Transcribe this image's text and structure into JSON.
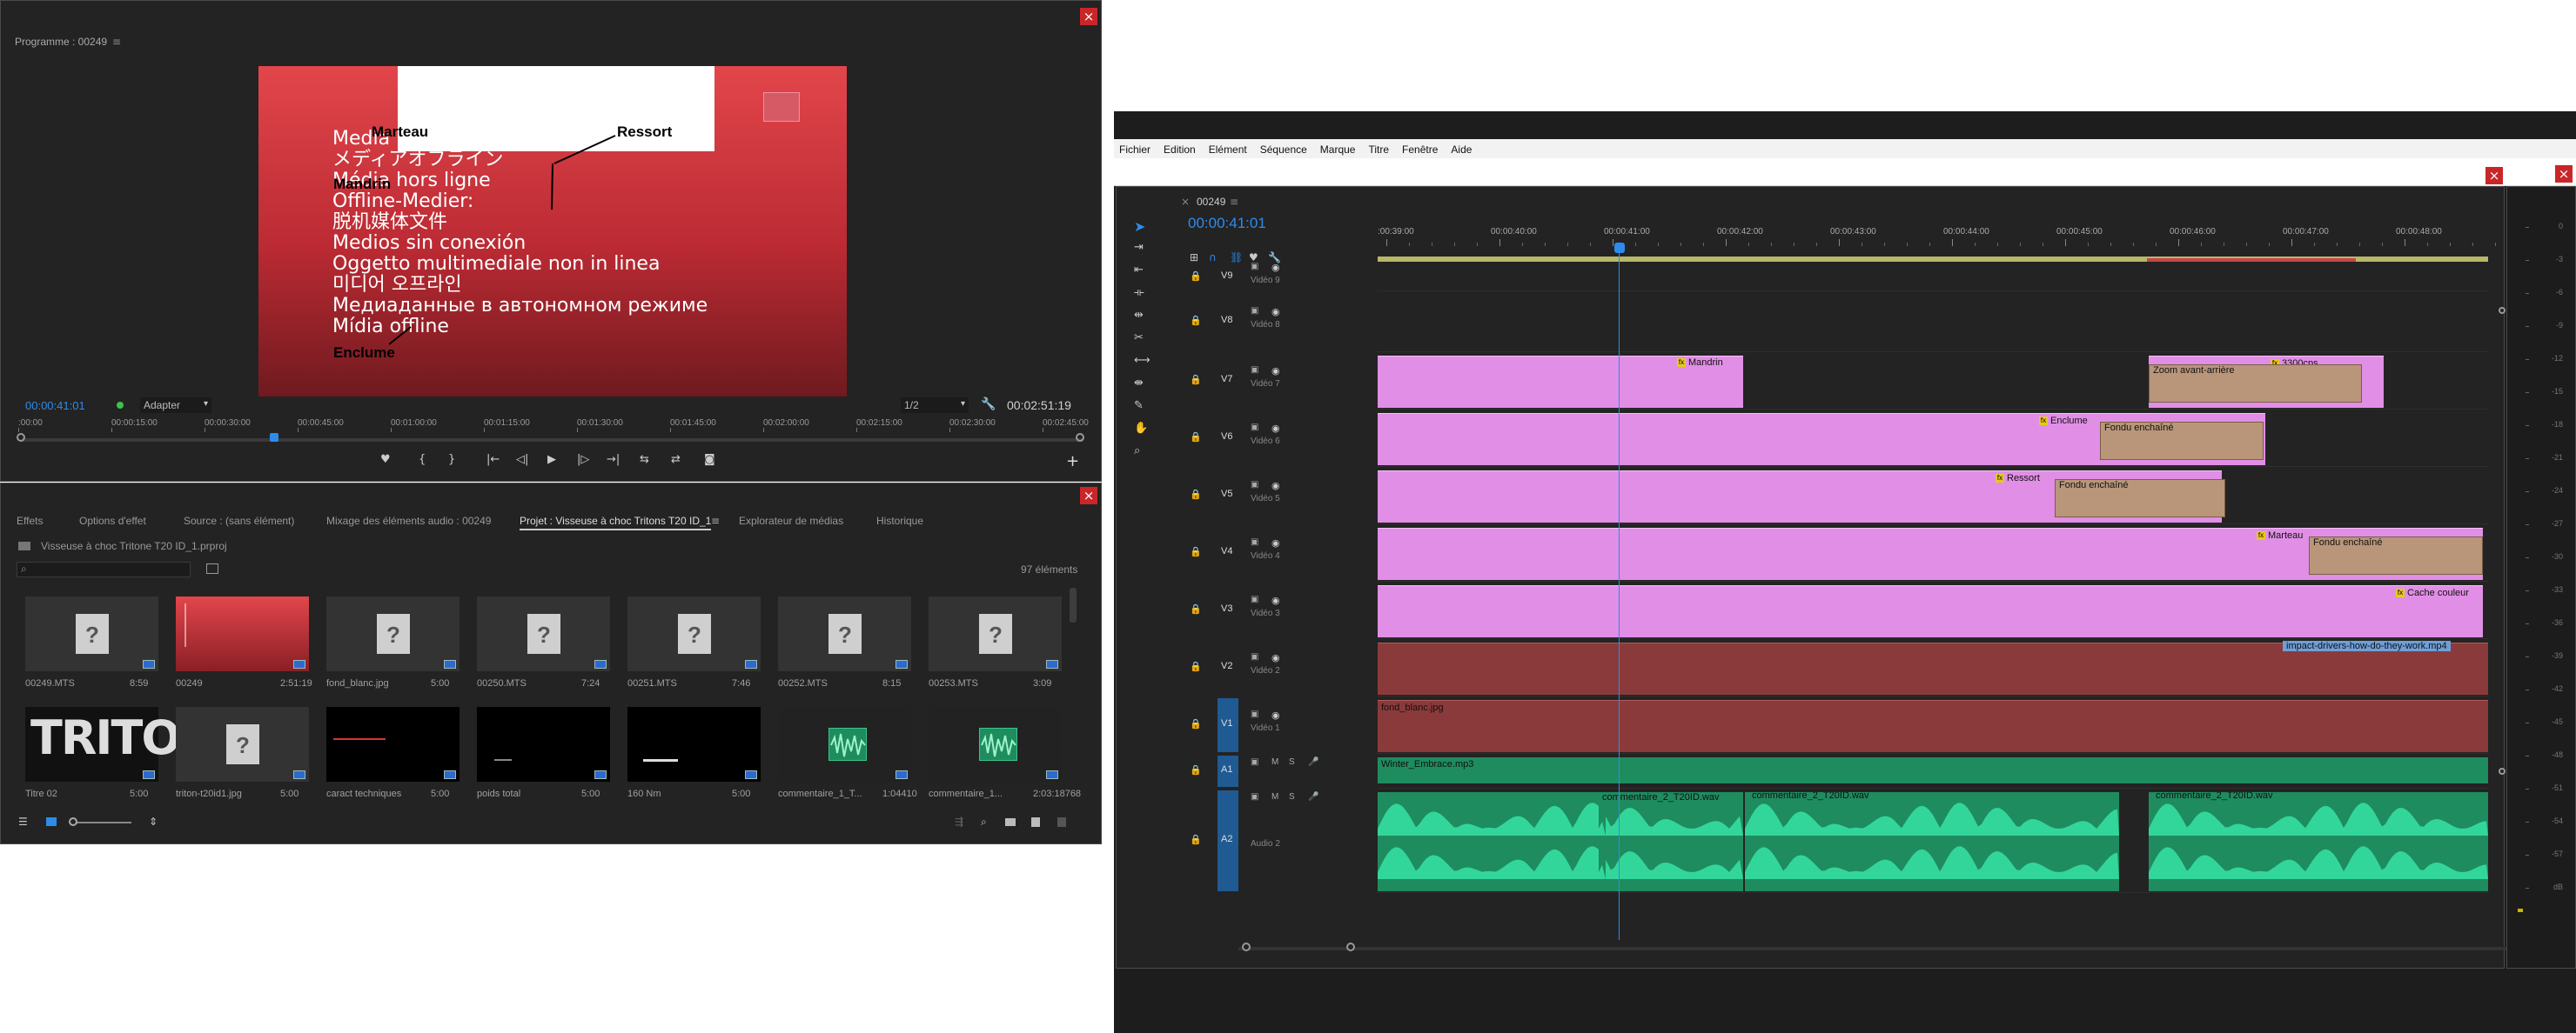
{
  "program_monitor": {
    "title": "Programme : 00249",
    "close": "×",
    "overlay_texts": [
      "Média hors ligne",
      "メディアオフライン",
      "Média hors ligne",
      "Offline-Medier:",
      "脱机媒体文件",
      "Medios sin conexión",
      "Oggetto multimediale non in linea",
      "미디어 오프라인",
      "Медиаданные в автономном режиме",
      "Mídia offline"
    ],
    "overlay_first": "Media",
    "callouts": {
      "marteau": "Marteau",
      "mandrin": "Mandrin",
      "ressort": "Ressort",
      "enclume": "Enclume"
    },
    "timecode": "00:00:41:01",
    "fit": "Adapter",
    "resolution": "1/2",
    "duration": "00:02:51:19",
    "ruler": [
      ":00:00",
      "00:00:15:00",
      "00:00:30:00",
      "00:00:45:00",
      "00:01:00:00",
      "00:01:15:00",
      "00:01:30:00",
      "00:01:45:00",
      "00:02:00:00",
      "00:02:15:00",
      "00:02:30:00",
      "00:02:45:00"
    ],
    "playhead_fraction": 0.238,
    "transport": [
      "♥",
      "{",
      "}",
      "|←",
      "◁|",
      "▶",
      "|▷",
      "→|",
      "⇆",
      "⇄",
      "◙",
      "+"
    ]
  },
  "project_panel": {
    "close": "×",
    "tabs": [
      "Effets",
      "Options d'effet",
      "Source : (sans élément)",
      "Mixage des éléments audio : 00249",
      "Projet : Visseuse à choc Tritons T20 ID_1",
      "Explorateur de médias",
      "Historique"
    ],
    "active_tab": 4,
    "project_file": "Visseuse à choc Tritone T20 ID_1.prproj",
    "search_placeholder": "",
    "count": "97 éléments",
    "items": [
      {
        "name": "00249.MTS",
        "dur": "8:59",
        "kind": "file"
      },
      {
        "name": "00249",
        "dur": "2:51:19",
        "kind": "seq"
      },
      {
        "name": "fond_blanc.jpg",
        "dur": "5:00",
        "kind": "file"
      },
      {
        "name": "00250.MTS",
        "dur": "7:24",
        "kind": "file"
      },
      {
        "name": "00251.MTS",
        "dur": "7:46",
        "kind": "file"
      },
      {
        "name": "00252.MTS",
        "dur": "8:15",
        "kind": "file"
      },
      {
        "name": "00253.MTS",
        "dur": "3:09",
        "kind": "file"
      },
      {
        "name": "Titre 02",
        "dur": "5:00",
        "kind": "triton"
      },
      {
        "name": "triton-t20id1.jpg",
        "dur": "5:00",
        "kind": "file"
      },
      {
        "name": "caract techniques",
        "dur": "5:00",
        "kind": "black-red"
      },
      {
        "name": "poids total",
        "dur": "5:00",
        "kind": "black"
      },
      {
        "name": "160 Nm",
        "dur": "5:00",
        "kind": "black-white"
      },
      {
        "name": "commentaire_1_T...",
        "dur": "1:04410",
        "kind": "audio"
      },
      {
        "name": "commentaire_1...",
        "dur": "2:03:18768",
        "kind": "audio"
      }
    ],
    "triton_text": "TRITON"
  },
  "menubar": [
    "Fichier",
    "Edition",
    "Elément",
    "Séquence",
    "Marque",
    "Titre",
    "Fenêtre",
    "Aide"
  ],
  "timeline": {
    "close": "×",
    "seq_name": "00249",
    "timecode": "00:00:41:01",
    "ruler": [
      ":00:39:00",
      "00:00:40:00",
      "00:00:41:00",
      "00:00:42:00",
      "00:00:43:00",
      "00:00:44:00",
      "00:00:45:00",
      "00:00:46:00",
      "00:00:47:00",
      "00:00:48:00"
    ],
    "tracks": [
      {
        "id": "V9",
        "name": "Vidéo 9"
      },
      {
        "id": "V8",
        "name": "Vidéo 8"
      },
      {
        "id": "V7",
        "name": "Vidéo 7"
      },
      {
        "id": "V6",
        "name": "Vidéo 6"
      },
      {
        "id": "V5",
        "name": "Vidéo 5"
      },
      {
        "id": "V4",
        "name": "Vidéo 4"
      },
      {
        "id": "V3",
        "name": "Vidéo 3"
      },
      {
        "id": "V2",
        "name": "Vidéo 2"
      },
      {
        "id": "V1",
        "name": "Vidéo 1"
      },
      {
        "id": "A1",
        "name": ""
      },
      {
        "id": "A2",
        "name": "Audio 2"
      }
    ],
    "clips": {
      "mandrin": "Mandrin",
      "zoom": "Zoom avant-arrière",
      "c3300": "3300cps",
      "enclume": "Enclume",
      "fondu1": "Fondu enchaîné",
      "ressort": "Ressort",
      "fondu2": "Fondu enchaîné",
      "marteau": "Marteau",
      "fondu3": "Fondu enchaîné",
      "cache": "Cache couleur",
      "impact": "impact-drivers-how-do-they-work.mp4",
      "fond": "fond_blanc.jpg",
      "winter": "Winter_Embrace.mp3",
      "comm1": "commentaire_2_T20ID.wav",
      "comm2": "commentaire_2_T20ID.wav",
      "comm3": "commentaire_2_T20ID.wav"
    }
  },
  "meter": {
    "close": "×",
    "labels": [
      "0",
      "-3",
      "-6",
      "-9",
      "-12",
      "-15",
      "-18",
      "-21",
      "-24",
      "-27",
      "-30",
      "-33",
      "-36",
      "-39",
      "-42",
      "-45",
      "-48",
      "-51",
      "-54",
      "-57",
      "dB"
    ]
  },
  "colors": {
    "accent": "#2d8ceb",
    "clip_pink": "#e18ee6",
    "clip_red": "#8a3a3a",
    "clip_audio": "#1e8c5f",
    "waveform": "#33d69a"
  }
}
